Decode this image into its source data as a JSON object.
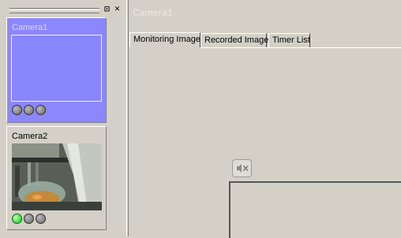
{
  "window": {
    "title": "Camera1"
  },
  "panel": {
    "dock_glyph": "⊡",
    "close_glyph": "✕"
  },
  "cameras": [
    {
      "name": "Camera1",
      "selected": true,
      "leds": [
        "off",
        "off",
        "off"
      ]
    },
    {
      "name": "Camera2",
      "selected": false,
      "leds": [
        "on",
        "off",
        "off"
      ]
    }
  ],
  "tabs": [
    {
      "label": "Monitoring Image",
      "active": true
    },
    {
      "label": "Recorded Image",
      "active": false
    },
    {
      "label": "Timer List",
      "active": false
    }
  ],
  "icons": {
    "mute": "speaker-mute-icon",
    "dock": "dock-icon",
    "close": "close-icon"
  },
  "colors": {
    "selected_card": "#8c87ff",
    "led_on": "#12c812",
    "background": "#d4d0c8"
  }
}
